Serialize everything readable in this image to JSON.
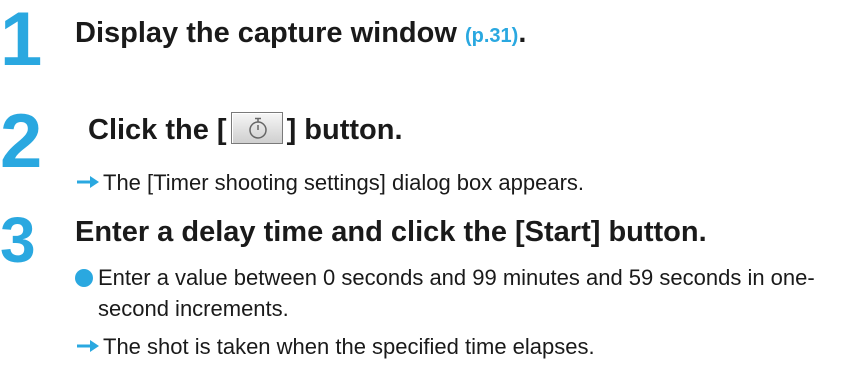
{
  "steps": [
    {
      "number": "1",
      "title": "Display the capture window",
      "ref": "(p.31)",
      "title_end": "."
    },
    {
      "number": "2",
      "title_prefix": "Click the [",
      "button_icon": "self-timer-icon",
      "title_suffix": "] button.",
      "result": "The [Timer shooting settings] dialog box appears."
    },
    {
      "number": "3",
      "title": "Enter a delay time and click the [Start] button.",
      "bullet": "Enter a value between 0 seconds and 99 minutes and 59 seconds in one-second increments.",
      "result": "The shot is taken when the specified time elapses."
    }
  ],
  "colors": {
    "accent": "#2aa8e0",
    "text": "#1a1a1a"
  }
}
